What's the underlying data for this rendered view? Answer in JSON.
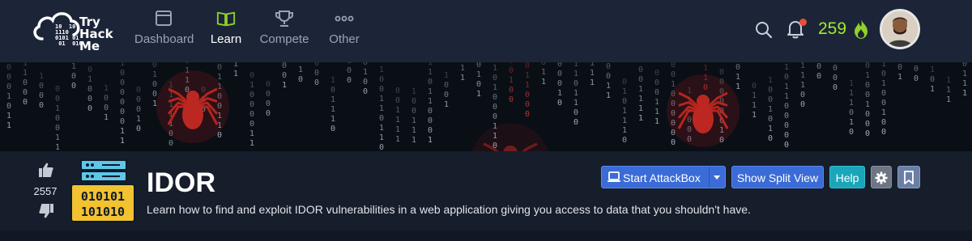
{
  "brand": {
    "name_line1": "Try",
    "name_line2": "Hack",
    "name_line3": "Me",
    "bits": "10  10\n1110\n0101 01\n 01  010"
  },
  "nav": {
    "items": [
      {
        "label": "Dashboard",
        "icon": "dashboard-icon",
        "active": false
      },
      {
        "label": "Learn",
        "icon": "book-icon",
        "active": true
      },
      {
        "label": "Compete",
        "icon": "trophy-icon",
        "active": false
      },
      {
        "label": "Other",
        "icon": "more-dots-icon",
        "active": false
      }
    ]
  },
  "user": {
    "streak": "259",
    "has_notifications": true
  },
  "room": {
    "title": "IDOR",
    "description": "Learn how to find and exploit IDOR vulnerabilities in a web application giving you access to data that you shouldn't have.",
    "votes": "2557",
    "icon_bits_line1": "010101",
    "icon_bits_line2": "101010"
  },
  "actions": {
    "start_attackbox": "Start AttackBox",
    "show_split_view": "Show Split View",
    "help": "Help"
  },
  "colors": {
    "navbar": "#1c2538",
    "accent_green": "#a3ea2a",
    "primary_blue": "#3b6bd6",
    "help_teal": "#1ba5b8",
    "notification_red": "#e74c3c"
  }
}
